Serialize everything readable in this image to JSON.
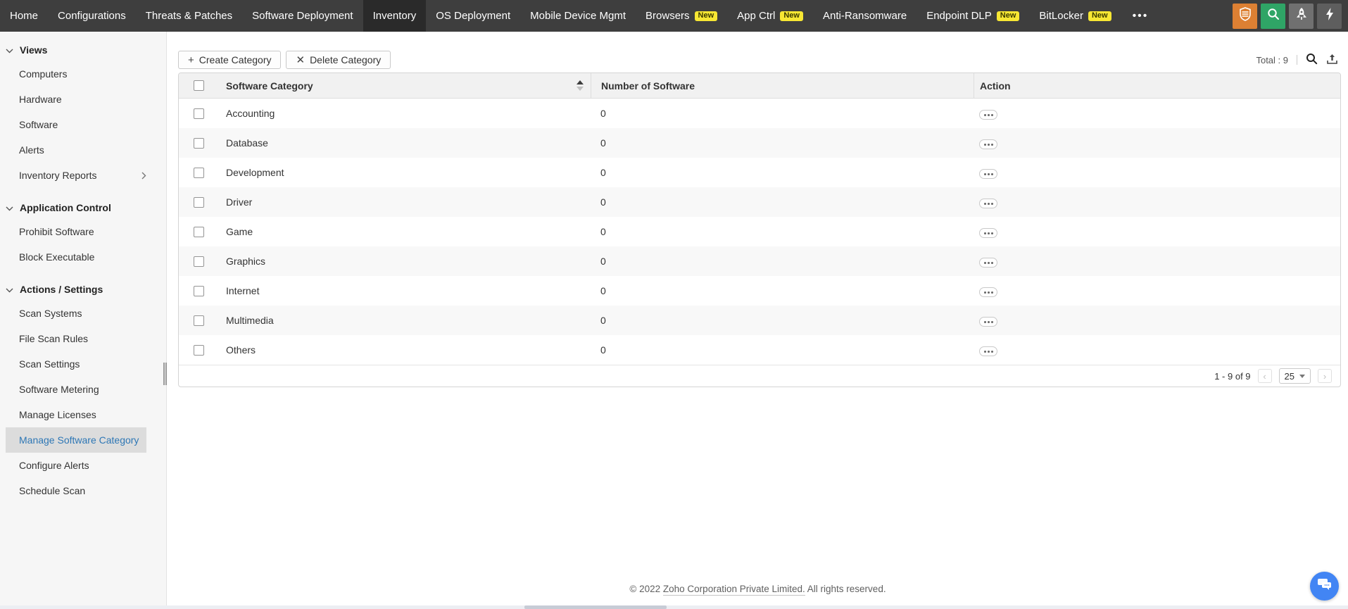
{
  "topnav": {
    "items": [
      {
        "label": "Home"
      },
      {
        "label": "Configurations"
      },
      {
        "label": "Threats & Patches"
      },
      {
        "label": "Software Deployment"
      },
      {
        "label": "Inventory",
        "active": true
      },
      {
        "label": "OS Deployment"
      },
      {
        "label": "Mobile Device Mgmt"
      },
      {
        "label": "Browsers",
        "badge": "New"
      },
      {
        "label": "App Ctrl",
        "badge": "New"
      },
      {
        "label": "Anti-Ransomware"
      },
      {
        "label": "Endpoint DLP",
        "badge": "New"
      },
      {
        "label": "BitLocker",
        "badge": "New"
      }
    ],
    "more_label": "•••",
    "right_icons": [
      "shield-icon",
      "search-icon",
      "rocket-icon",
      "lightning-icon"
    ]
  },
  "sidebar": {
    "sections": [
      {
        "title": "Views",
        "items": [
          {
            "label": "Computers"
          },
          {
            "label": "Hardware"
          },
          {
            "label": "Software"
          },
          {
            "label": "Alerts"
          },
          {
            "label": "Inventory Reports",
            "has_submenu": true
          }
        ]
      },
      {
        "title": "Application Control",
        "items": [
          {
            "label": "Prohibit Software"
          },
          {
            "label": "Block Executable"
          }
        ]
      },
      {
        "title": "Actions / Settings",
        "items": [
          {
            "label": "Scan Systems"
          },
          {
            "label": "File Scan Rules"
          },
          {
            "label": "Scan Settings"
          },
          {
            "label": "Software Metering"
          },
          {
            "label": "Manage Licenses"
          },
          {
            "label": "Manage Software Category",
            "selected": true
          },
          {
            "label": "Configure Alerts"
          },
          {
            "label": "Schedule Scan"
          }
        ]
      }
    ]
  },
  "toolbar": {
    "create_icon": "+",
    "create_label": "Create Category",
    "delete_icon": "✕",
    "delete_label": "Delete Category",
    "total_label": "Total : 9"
  },
  "table": {
    "columns": [
      "Software Category",
      "Number of Software",
      "Action"
    ],
    "rows": [
      {
        "category": "Accounting",
        "count": "0"
      },
      {
        "category": "Database",
        "count": "0"
      },
      {
        "category": "Development",
        "count": "0"
      },
      {
        "category": "Driver",
        "count": "0"
      },
      {
        "category": "Game",
        "count": "0"
      },
      {
        "category": "Graphics",
        "count": "0"
      },
      {
        "category": "Internet",
        "count": "0"
      },
      {
        "category": "Multimedia",
        "count": "0"
      },
      {
        "category": "Others",
        "count": "0"
      }
    ]
  },
  "pagination": {
    "range": "1 - 9 of 9",
    "prev": "‹",
    "next": "›",
    "page_size": "25"
  },
  "footer": {
    "prefix": "© 2022",
    "link": "Zoho Corporation Private Limited.",
    "suffix": "All rights reserved."
  },
  "colors": {
    "nav_bg": "#3e3e3e",
    "nav_active_bg": "#2a2a2a",
    "badge_yellow": "#f7e733",
    "shield_orange": "#dd8033",
    "search_green": "#2fa566",
    "selected_item_blue": "#2e77b5",
    "selected_item_bg": "#dcdcdc",
    "chat_blue": "#4285f4"
  }
}
